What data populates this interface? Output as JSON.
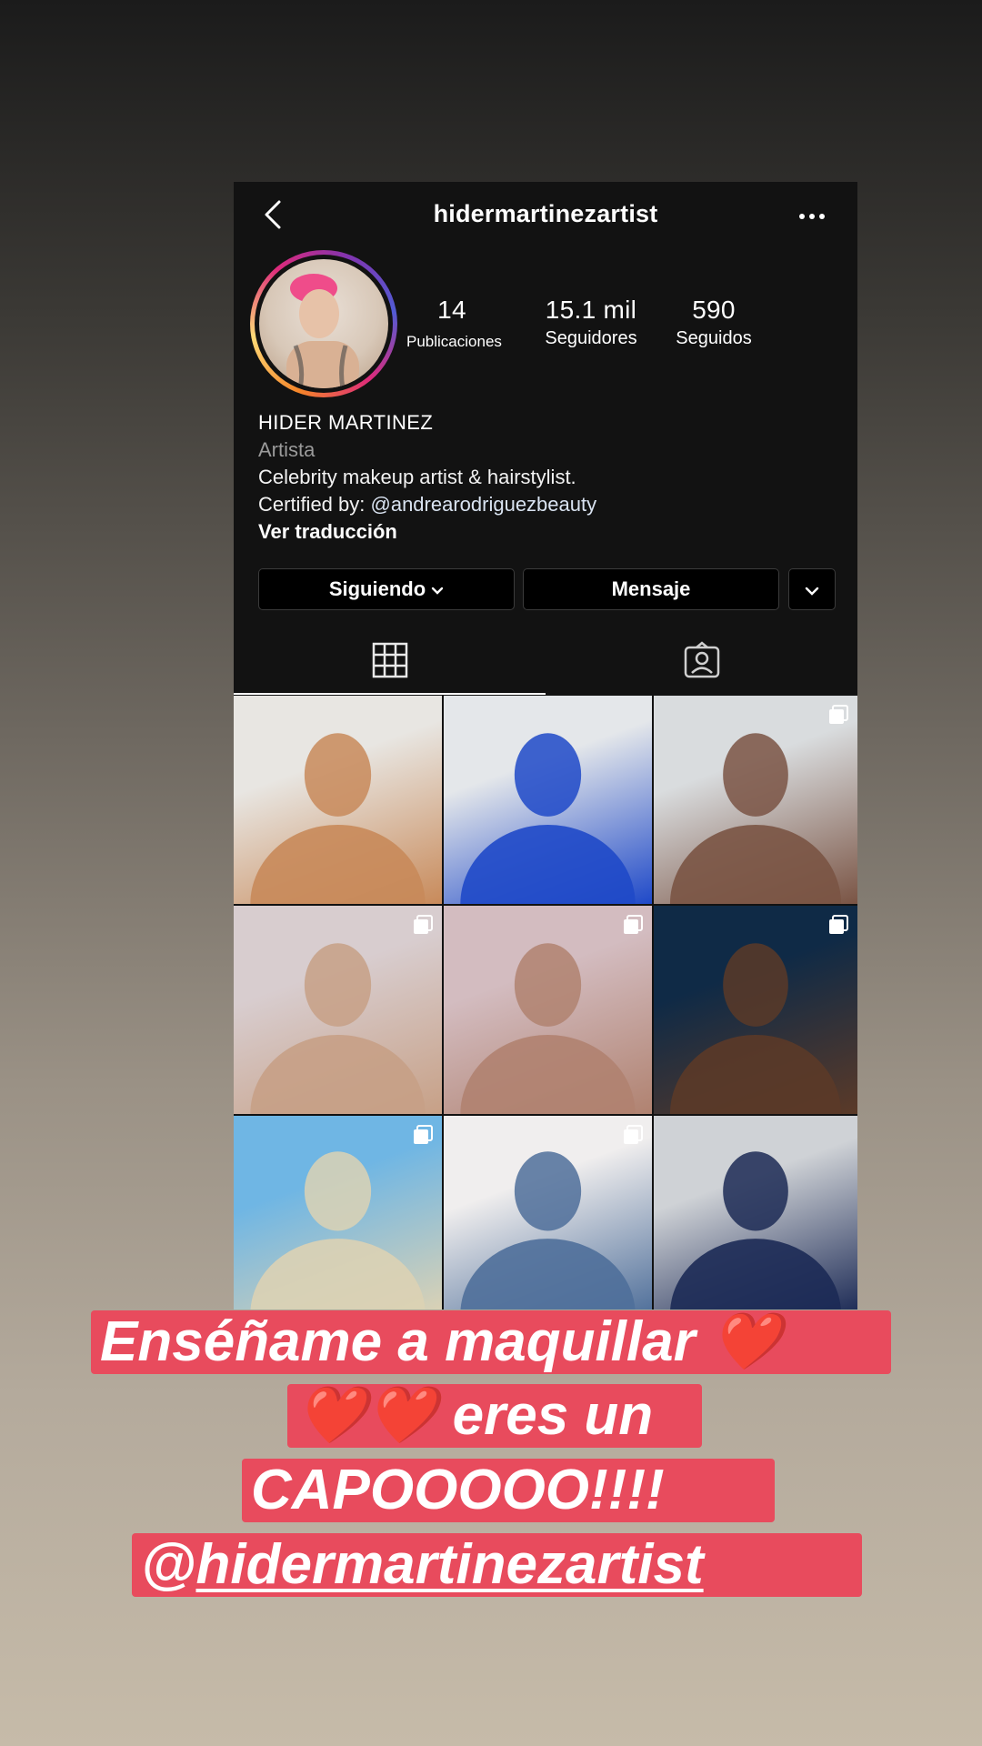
{
  "profile": {
    "username": "hidermartinezartist",
    "name": "HIDER MARTINEZ",
    "category": "Artista",
    "bio_line1": "Celebrity makeup artist & hairstylist.",
    "bio_line2_prefix": "Certified by: ",
    "bio_mention": "@andrearodriguezbeauty",
    "translate_link": "Ver traducción"
  },
  "stats": [
    {
      "value": "14",
      "label": "Publicaciones"
    },
    {
      "value": "15.1 mil",
      "label": "Seguidores"
    },
    {
      "value": "590",
      "label": "Seguidos"
    }
  ],
  "buttons": {
    "following": "Siguiendo",
    "message": "Mensaje"
  },
  "tabs": [
    {
      "icon": "grid-icon",
      "active": true
    },
    {
      "icon": "tagged-icon",
      "active": false
    }
  ],
  "posts": [
    {
      "colors": [
        "#e8e6e2",
        "#c88a5a"
      ],
      "multiple": false
    },
    {
      "colors": [
        "#e4e7ea",
        "#1f49c8"
      ],
      "multiple": false
    },
    {
      "colors": [
        "#d9dcde",
        "#7a5444"
      ],
      "multiple": true
    },
    {
      "colors": [
        "#d8cdcf",
        "#c7a086"
      ],
      "multiple": true
    },
    {
      "colors": [
        "#d3bcc0",
        "#b08270"
      ],
      "multiple": true
    },
    {
      "colors": [
        "#0f2a46",
        "#5b3a28"
      ],
      "multiple": true
    },
    {
      "colors": [
        "#6fb6e4",
        "#dcd2b4"
      ],
      "multiple": true
    },
    {
      "colors": [
        "#f0eeee",
        "#4f6f9a"
      ],
      "multiple": true
    },
    {
      "colors": [
        "#cfd2d6",
        "#1c2a55"
      ],
      "multiple": false
    }
  ],
  "caption": {
    "line1": "Enséñame a maquillar ❤️",
    "line2": "❤️❤️ eres un",
    "line3": "CAPOOOOO!!!!",
    "line4_at": "@",
    "line4_handle": "hidermartinezartist"
  },
  "colors": {
    "caption_bg": "#e84b5d",
    "app_bg": "#121212"
  }
}
